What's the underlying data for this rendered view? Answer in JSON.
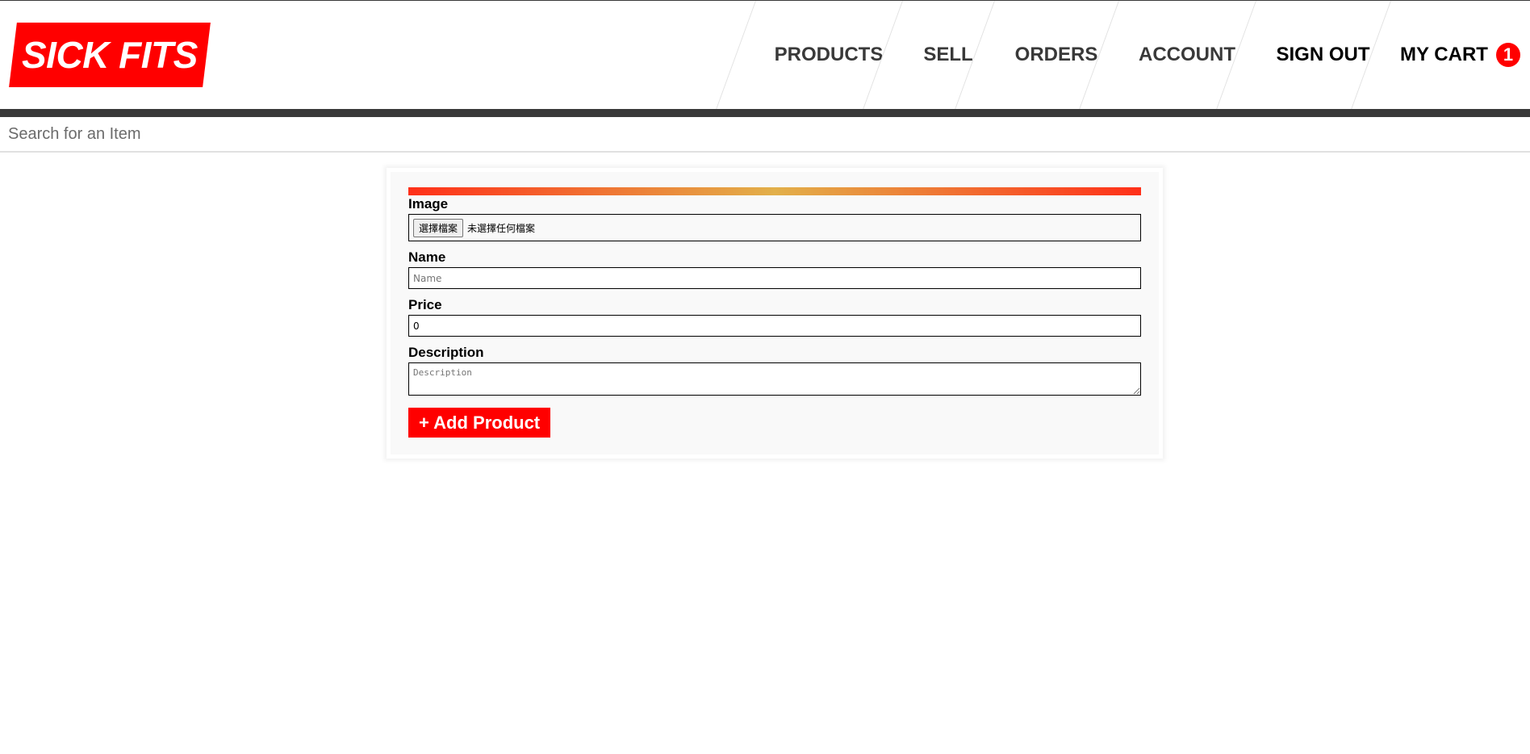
{
  "brand": {
    "logo_text": "SICK FITS",
    "accent_color": "#ff0000"
  },
  "nav": {
    "items": [
      {
        "label": "PRODUCTS"
      },
      {
        "label": "SELL"
      },
      {
        "label": "ORDERS"
      },
      {
        "label": "ACCOUNT"
      },
      {
        "label": "SIGN OUT"
      },
      {
        "label": "MY CART"
      }
    ],
    "cart_count": "1"
  },
  "search": {
    "placeholder": "Search for an Item",
    "value": ""
  },
  "form": {
    "image": {
      "label": "Image",
      "button_label": "選擇檔案",
      "status_text": "未選擇任何檔案"
    },
    "name": {
      "label": "Name",
      "placeholder": "Name",
      "value": ""
    },
    "price": {
      "label": "Price",
      "value": "0"
    },
    "description": {
      "label": "Description",
      "placeholder": "Description",
      "value": ""
    },
    "submit_label": "+ Add Product",
    "gradient_colors": [
      "#ff3019",
      "#e2b04a",
      "#ff3019"
    ]
  }
}
